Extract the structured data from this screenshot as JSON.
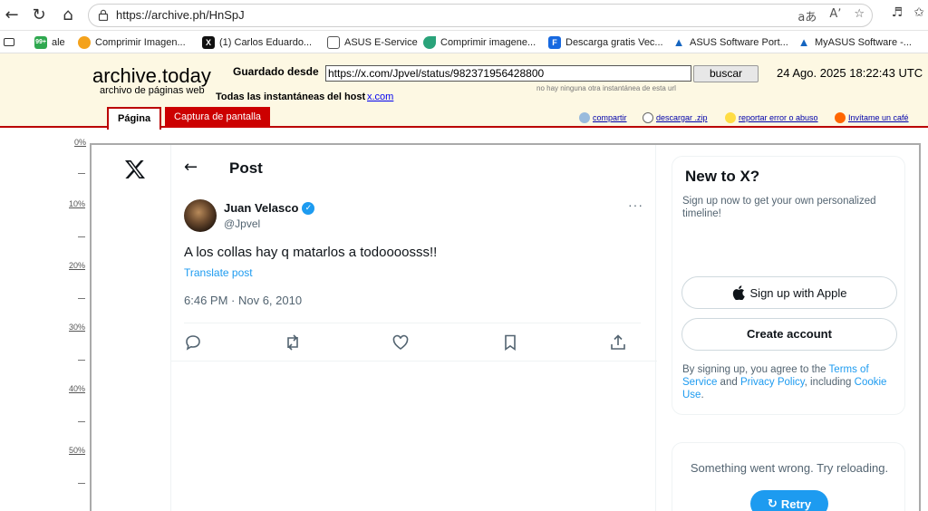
{
  "browser": {
    "url": "https://archive.ph/HnSpJ",
    "read_aloud": "aあ",
    "text_size": "Aʼ"
  },
  "bookmarks": [
    {
      "label": "ale",
      "badge": "99+",
      "color": "#2fa84f"
    },
    {
      "label": "Comprimir Imagen...",
      "badge": "",
      "color": "#f4a21c"
    },
    {
      "label": "(1) Carlos Eduardo...",
      "badge": "X",
      "color": "#111111"
    },
    {
      "label": "ASUS E-Service",
      "badge": "",
      "color": "#ffffff"
    },
    {
      "label": "Comprimir imagene...",
      "badge": "",
      "color": "#2aa37a"
    },
    {
      "label": "Descarga gratis Vec...",
      "badge": "F",
      "color": "#1769e0"
    },
    {
      "label": "ASUS Software Port...",
      "badge": "",
      "color": "#1565c0"
    },
    {
      "label": "MyASUS Software -...",
      "badge": "",
      "color": "#1565c0"
    }
  ],
  "archive": {
    "logo": "archive.today",
    "logo_sub": "archivo de páginas web",
    "saved_from_label": "Guardado desde",
    "saved_url": "https://x.com/Jpvel/status/982371956428800",
    "no_other": "no hay ninguna otra instantánea de esta url",
    "search_button": "buscar",
    "datetime": "24 Ago. 2025 18:22:43 UTC",
    "all_snapshots": "Todas las instantáneas",
    "from_host": "del host",
    "host": "x.com",
    "tab_page": "Página",
    "tab_screenshot": "Captura de pantalla",
    "share": "compartir",
    "download": "descargar .zip",
    "report": "reportar error o abuso",
    "coffee": "Invítame un café"
  },
  "ruler": [
    "0%",
    "10%",
    "20%",
    "30%",
    "40%",
    "50%"
  ],
  "post": {
    "header": "Post",
    "display_name": "Juan Velasco",
    "handle": "@Jpvel",
    "text": "A los collas hay q matarlos a todoooosss!!",
    "translate": "Translate post",
    "timestamp": "6:46 PM · Nov 6, 2010"
  },
  "signup": {
    "title": "New to X?",
    "subtitle": "Sign up now to get your own personalized timeline!",
    "apple_button": "Sign up with Apple",
    "create_button": "Create account",
    "terms_1": "By signing up, you agree to the ",
    "terms_link1": "Terms of Service",
    "terms_2": " and ",
    "terms_link2": "Privacy Policy",
    "terms_3": ", including ",
    "terms_link3": "Cookie Use",
    "terms_4": "."
  },
  "error_box": {
    "message": "Something went wrong. Try reloading.",
    "retry": "Retry"
  }
}
